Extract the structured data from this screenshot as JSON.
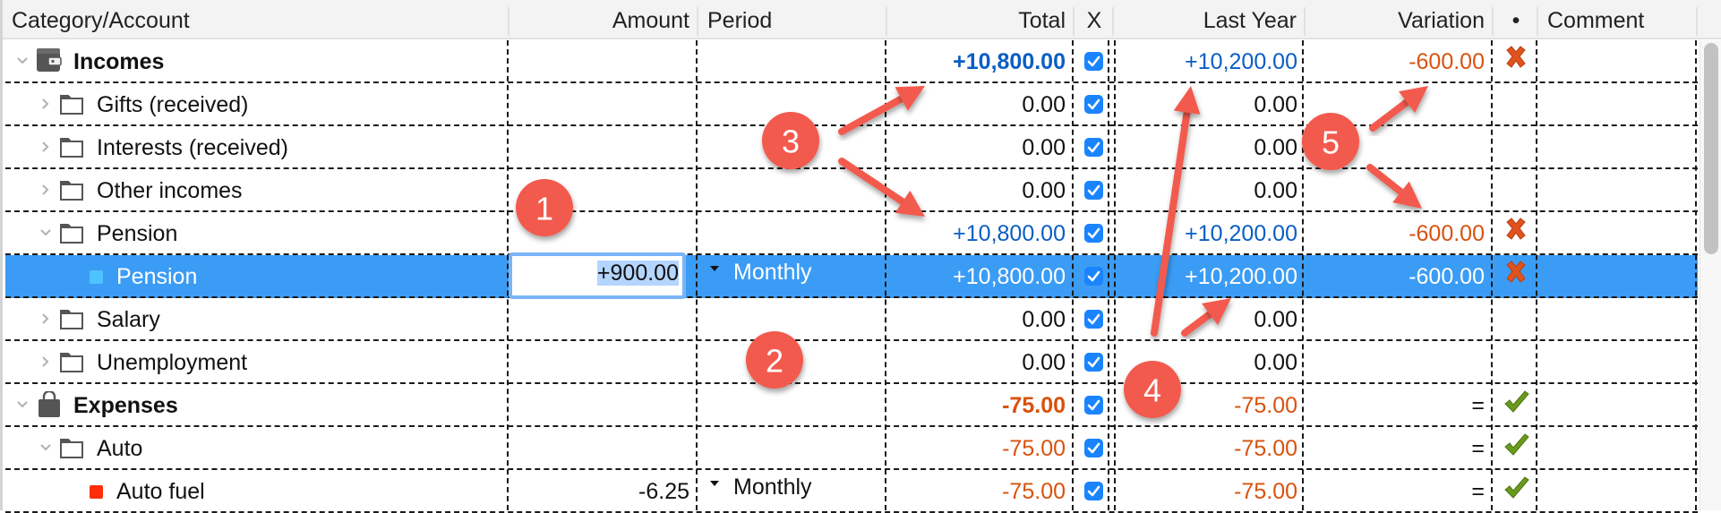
{
  "columns": {
    "category": "Category/Account",
    "amount": "Amount",
    "period": "Period",
    "total": "Total",
    "x": "X",
    "last_year": "Last Year",
    "variation": "Variation",
    "status": "•",
    "comment": "Comment"
  },
  "rows": [
    {
      "name": "Incomes",
      "level": 0,
      "type": "group",
      "icon": "wallet-icon",
      "expanded": true,
      "amount": "",
      "period": "",
      "total": "+10,800.00",
      "total_style": "pos",
      "checked": true,
      "last_year": "+10,200.00",
      "last_year_style": "pos",
      "variation": "-600.00",
      "variation_style": "neg",
      "status": "cross-icon",
      "bold": true
    },
    {
      "name": "Gifts (received)",
      "level": 1,
      "type": "folder",
      "icon": "folder-icon",
      "expanded": false,
      "amount": "",
      "period": "",
      "total": "0.00",
      "total_style": "zero",
      "checked": true,
      "last_year": "0.00",
      "last_year_style": "zero",
      "variation": "",
      "variation_style": "zero",
      "status": ""
    },
    {
      "name": "Interests (received)",
      "level": 1,
      "type": "folder",
      "icon": "folder-icon",
      "expanded": false,
      "amount": "",
      "period": "",
      "total": "0.00",
      "total_style": "zero",
      "checked": true,
      "last_year": "0.00",
      "last_year_style": "zero",
      "variation": "",
      "variation_style": "zero",
      "status": ""
    },
    {
      "name": "Other incomes",
      "level": 1,
      "type": "folder",
      "icon": "folder-icon",
      "expanded": false,
      "amount": "",
      "period": "",
      "total": "0.00",
      "total_style": "zero",
      "checked": true,
      "last_year": "0.00",
      "last_year_style": "zero",
      "variation": "",
      "variation_style": "zero",
      "status": ""
    },
    {
      "name": "Pension",
      "level": 1,
      "type": "folder",
      "icon": "folder-icon",
      "expanded": true,
      "amount": "",
      "period": "",
      "total": "+10,800.00",
      "total_style": "pos",
      "checked": true,
      "last_year": "+10,200.00",
      "last_year_style": "pos",
      "variation": "-600.00",
      "variation_style": "neg",
      "status": "cross-icon"
    },
    {
      "name": "Pension",
      "level": 2,
      "type": "account",
      "icon": "account-square-icon",
      "square_color": "#4fc3ff",
      "amount": "+900.00",
      "period": "Monthly",
      "total": "+10,800.00",
      "total_style": "pos",
      "checked": true,
      "last_year": "+10,200.00",
      "last_year_style": "pos",
      "variation": "-600.00",
      "variation_style": "neg",
      "status": "cross-icon",
      "selected": true,
      "editing": true
    },
    {
      "name": "Salary",
      "level": 1,
      "type": "folder",
      "icon": "folder-icon",
      "expanded": false,
      "amount": "",
      "period": "",
      "total": "0.00",
      "total_style": "zero",
      "checked": true,
      "last_year": "0.00",
      "last_year_style": "zero",
      "variation": "",
      "variation_style": "zero",
      "status": ""
    },
    {
      "name": "Unemployment",
      "level": 1,
      "type": "folder",
      "icon": "folder-icon",
      "expanded": false,
      "amount": "",
      "period": "",
      "total": "0.00",
      "total_style": "zero",
      "checked": true,
      "last_year": "0.00",
      "last_year_style": "zero",
      "variation": "",
      "variation_style": "zero",
      "status": ""
    },
    {
      "name": "Expenses",
      "level": 0,
      "type": "group",
      "icon": "shopping-bag-icon",
      "expanded": true,
      "amount": "",
      "period": "",
      "total": "-75.00",
      "total_style": "neg",
      "checked": true,
      "last_year": "-75.00",
      "last_year_style": "neg",
      "variation": "=",
      "variation_style": "zero",
      "status": "check-icon",
      "bold": true
    },
    {
      "name": "Auto",
      "level": 1,
      "type": "folder",
      "icon": "folder-icon",
      "expanded": true,
      "amount": "",
      "period": "",
      "total": "-75.00",
      "total_style": "neg",
      "checked": true,
      "last_year": "-75.00",
      "last_year_style": "neg",
      "variation": "=",
      "variation_style": "zero",
      "status": "check-icon"
    },
    {
      "name": "Auto fuel",
      "level": 2,
      "type": "account",
      "icon": "account-square-icon",
      "square_color": "#ff2d0a",
      "amount": "-6.25",
      "period": "Monthly",
      "total": "-75.00",
      "total_style": "neg",
      "checked": true,
      "last_year": "-75.00",
      "last_year_style": "neg",
      "variation": "=",
      "variation_style": "zero",
      "status": "check-icon"
    }
  ],
  "annotations": [
    {
      "label": "1"
    },
    {
      "label": "2"
    },
    {
      "label": "3"
    },
    {
      "label": "4"
    },
    {
      "label": "5"
    }
  ],
  "colors": {
    "positive": "#0a5ec4",
    "negative": "#d9520e",
    "selection": "#3b9cf5",
    "checkbox": "#1a84ff",
    "annotation": "#f25a4e",
    "cross": "#e0531e",
    "check": "#6a9a1c"
  }
}
